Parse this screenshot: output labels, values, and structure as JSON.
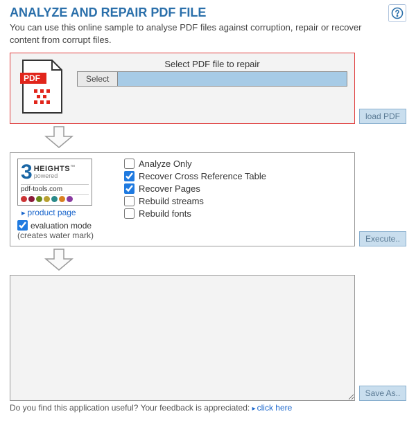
{
  "title": "ANALYZE AND REPAIR PDF FILE",
  "subtitle": "You can use this online sample to analyse PDF files against corruption, repair or recover content from corrupt files.",
  "help_icon": "help-icon",
  "step1": {
    "label": "Select PDF file to repair",
    "select_btn": "Select",
    "side_btn": "load PDF"
  },
  "step2": {
    "logo_heights": "HEIGHTS",
    "logo_powered": "powered",
    "logo_url": "pdf-tools.com",
    "product_link": "product page",
    "eval_label": "evaluation mode",
    "eval_note": "(creates water mark)",
    "eval_checked": true,
    "options": [
      {
        "label": "Analyze Only",
        "checked": false
      },
      {
        "label": "Recover Cross Reference Table",
        "checked": true
      },
      {
        "label": "Recover Pages",
        "checked": true
      },
      {
        "label": "Rebuild streams",
        "checked": false
      },
      {
        "label": "Rebuild fonts",
        "checked": false
      }
    ],
    "side_btn": "Execute.."
  },
  "step3": {
    "side_btn": "Save As.."
  },
  "footer": {
    "text": "Do you find this application useful? Your feedback is appreciated: ",
    "link": "click here"
  }
}
